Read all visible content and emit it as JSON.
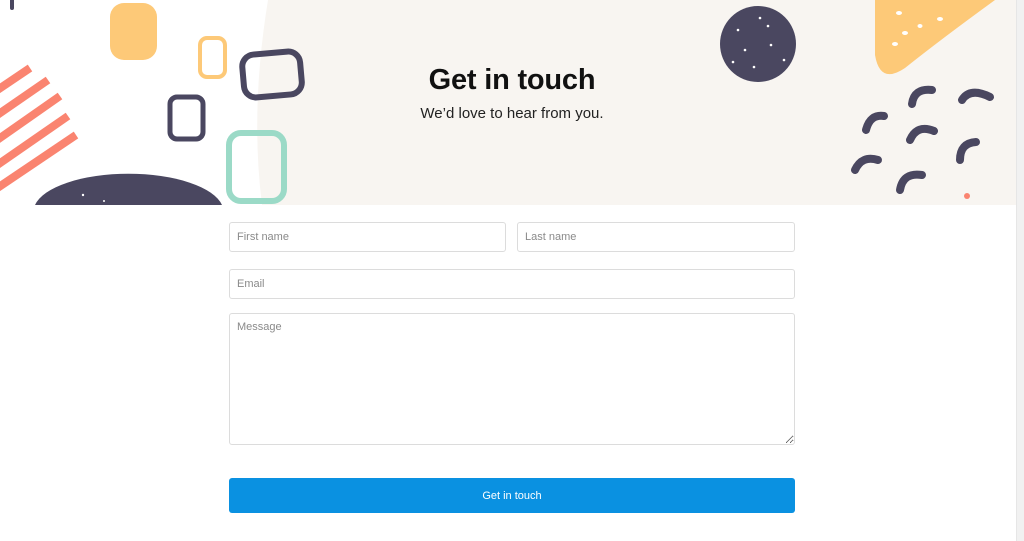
{
  "hero": {
    "title": "Get in touch",
    "subtitle": "We’d love to hear from you."
  },
  "form": {
    "first_name_placeholder": "First name",
    "first_name_value": "",
    "last_name_placeholder": "Last name",
    "last_name_value": "",
    "email_placeholder": "Email",
    "email_value": "",
    "message_placeholder": "Message",
    "message_value": "",
    "submit_label": "Get in touch"
  },
  "colors": {
    "primary_button": "#0a91e1",
    "hero_background": "#f8f5f1",
    "decor_navy": "#4a4760",
    "decor_coral": "#fa8470",
    "decor_yellow": "#fdc978",
    "decor_mint": "#9bdac7"
  }
}
